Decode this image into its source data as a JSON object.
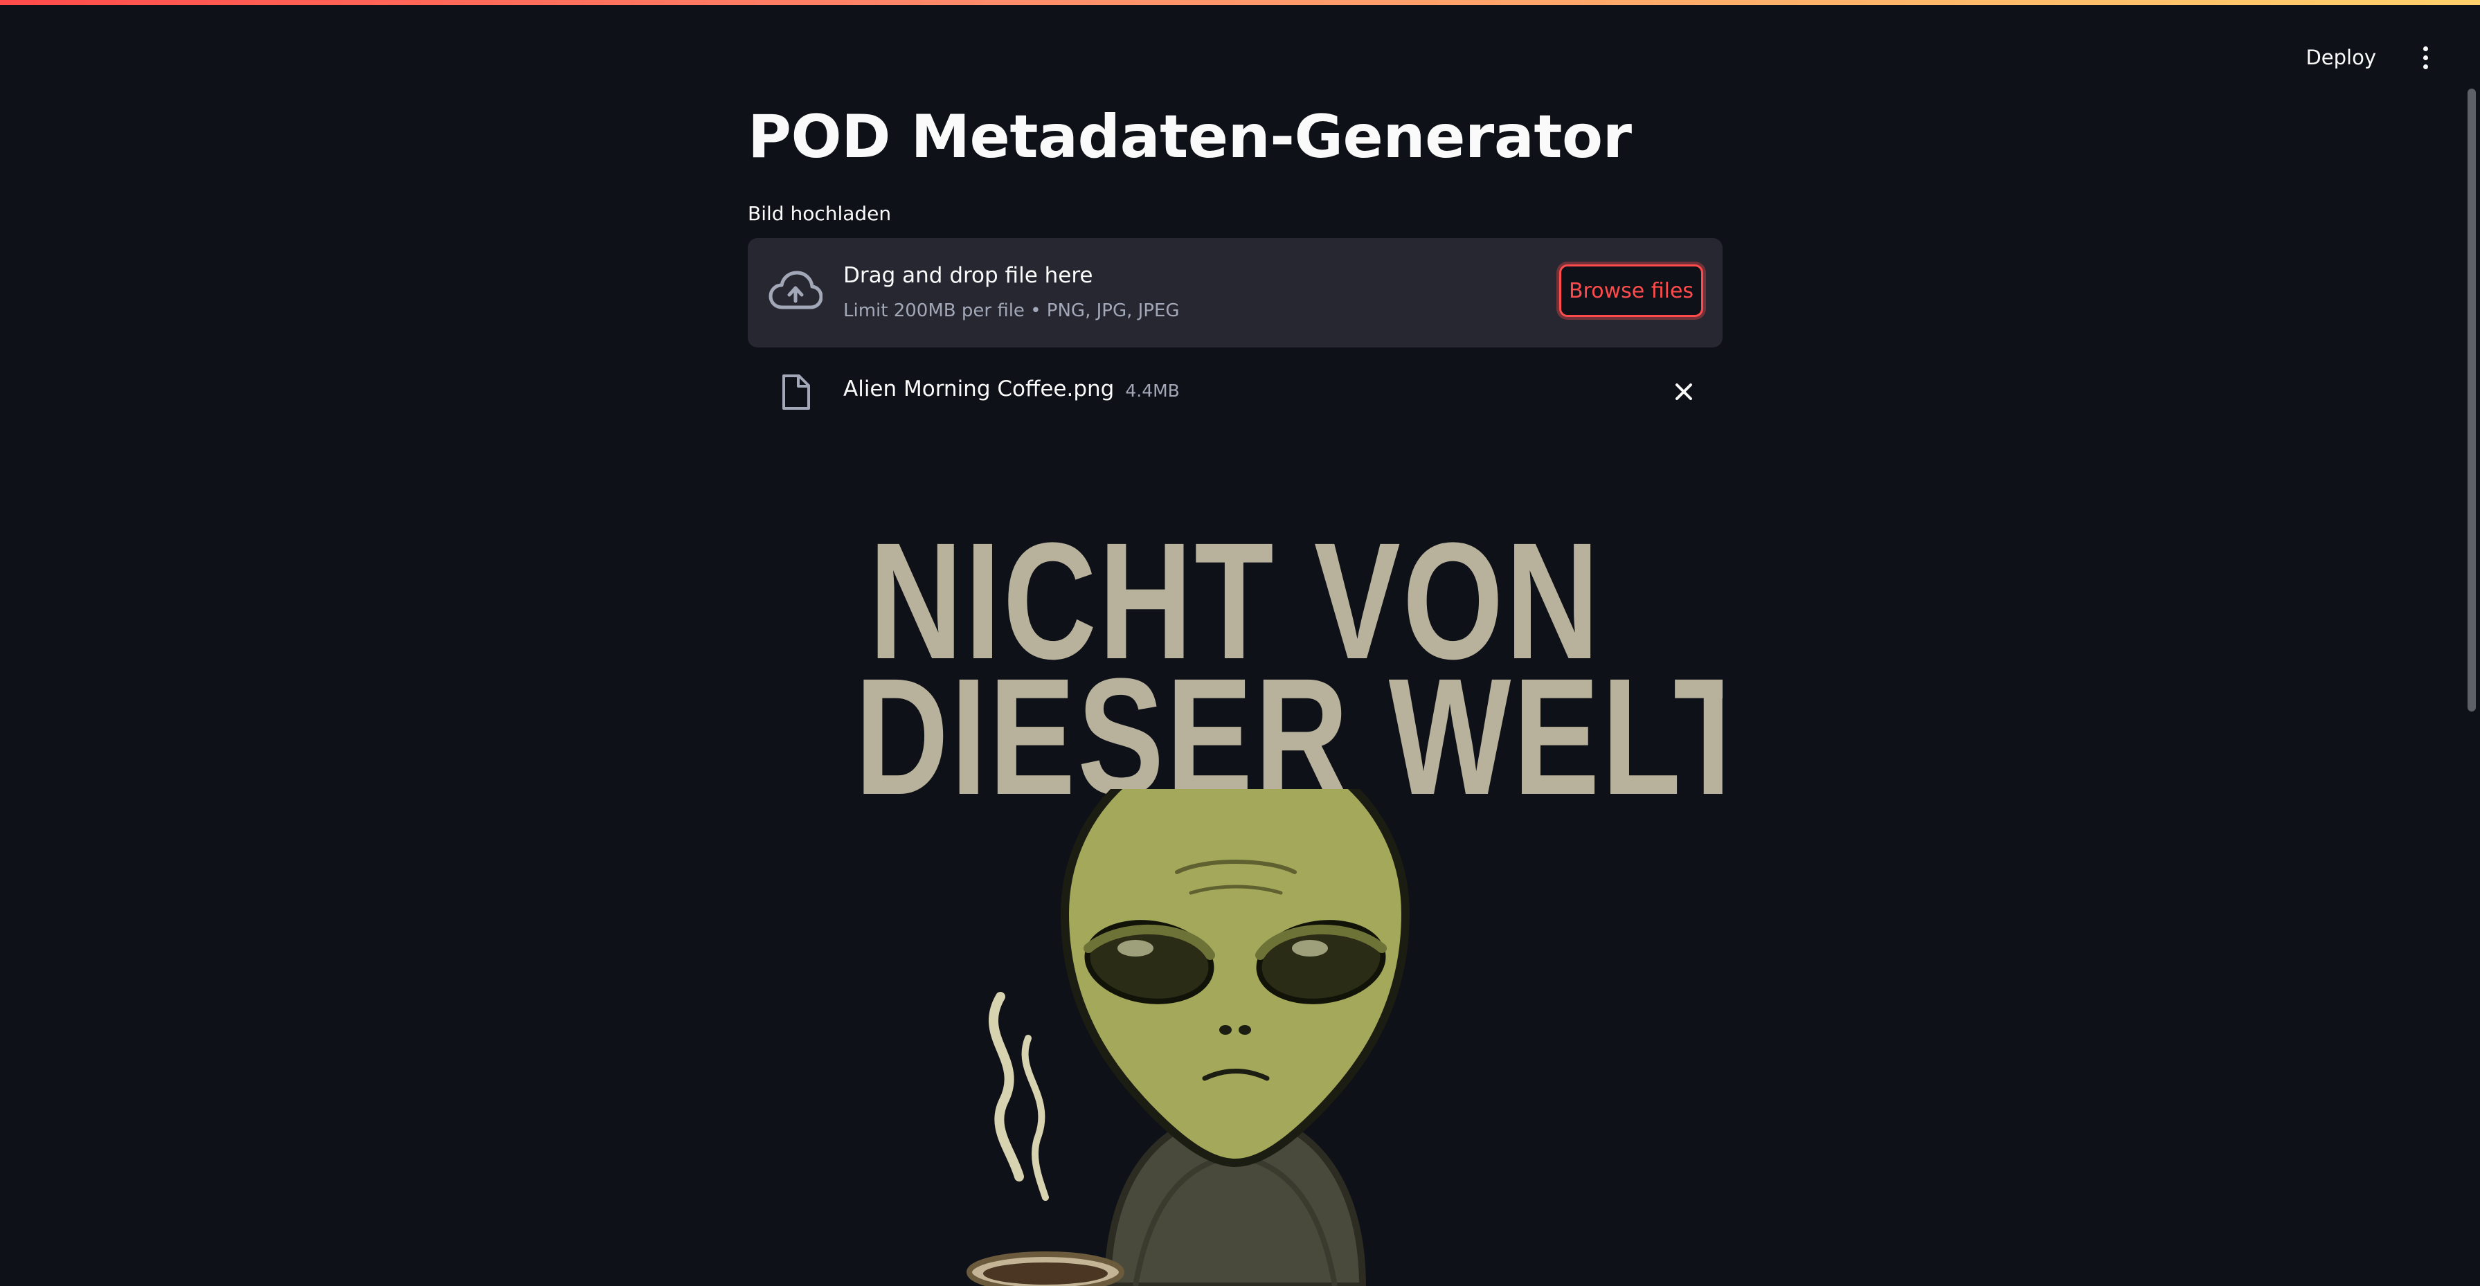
{
  "header": {
    "deploy_label": "Deploy",
    "menu_icon": "kebab-menu-icon"
  },
  "page": {
    "title": "POD Metadaten-Generator"
  },
  "uploader": {
    "label": "Bild hochladen",
    "drop_title": "Drag and drop file here",
    "drop_subtitle": "Limit 200MB per file • PNG, JPG, JPEG",
    "browse_label": "Browse files",
    "upload_icon": "cloud-upload-icon"
  },
  "uploaded_file": {
    "name": "Alien Morning Coffee.png",
    "size": "4.4MB",
    "icon": "file-icon",
    "remove_icon": "close-icon"
  },
  "preview_image": {
    "line1": "NICHT VON",
    "line2": "DIESER WELT"
  },
  "colors": {
    "background": "#0e1117",
    "dropzone": "#262730",
    "accent": "#ff4b4b",
    "poster_text": "#b8b29c",
    "alien_skin": "#a3a85a"
  }
}
